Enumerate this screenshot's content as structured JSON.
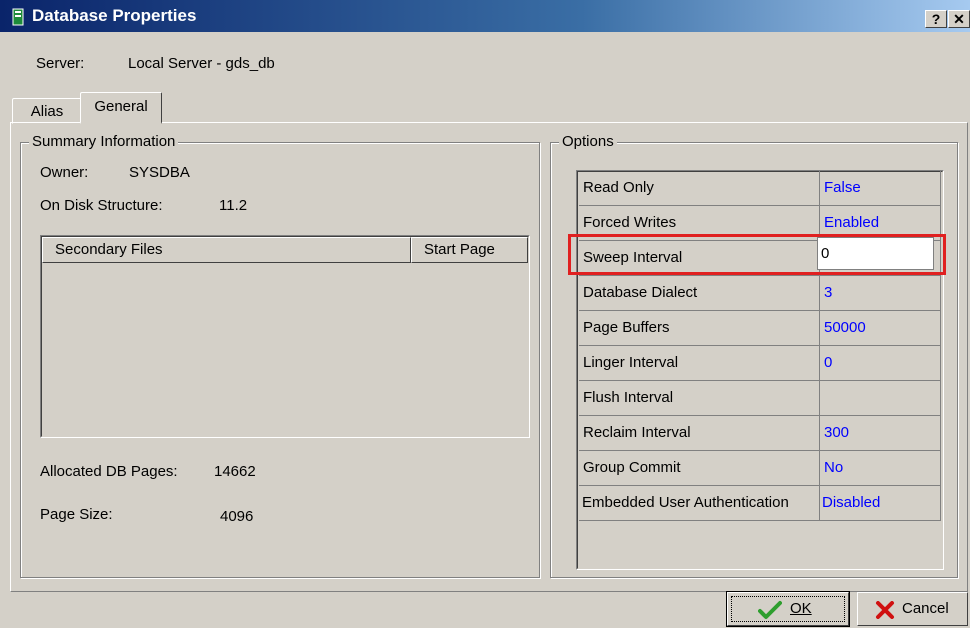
{
  "window": {
    "title": "Database Properties",
    "help_label": "?",
    "close_label": "✕"
  },
  "server": {
    "label": "Server:",
    "value": "Local Server - gds_db"
  },
  "tabs": [
    {
      "label": "Alias"
    },
    {
      "label": "General"
    }
  ],
  "summary": {
    "title": "Summary Information",
    "owner_label": "Owner:",
    "owner_value": "SYSDBA",
    "ods_label": "On Disk Structure:",
    "ods_value": "11.2",
    "columns": [
      "Secondary Files",
      "Start Page"
    ],
    "allocated_label": "Allocated DB Pages:",
    "allocated_value": "14662",
    "page_size_label": "Page Size:",
    "page_size_value": "4096"
  },
  "options": {
    "title": "Options",
    "rows": [
      {
        "name": "Read Only",
        "value": "False"
      },
      {
        "name": "Forced Writes",
        "value": "Enabled"
      },
      {
        "name": "Sweep Interval",
        "value": "0"
      },
      {
        "name": "Database Dialect",
        "value": "3"
      },
      {
        "name": "Page Buffers",
        "value": "50000"
      },
      {
        "name": "Linger Interval",
        "value": "0"
      },
      {
        "name": "Flush Interval",
        "value": ""
      },
      {
        "name": "Reclaim Interval",
        "value": "300"
      },
      {
        "name": "Group Commit",
        "value": "No"
      },
      {
        "name": "Embedded User Authentication",
        "value": "Disabled"
      }
    ]
  },
  "buttons": {
    "ok": "OK",
    "cancel": "Cancel"
  },
  "colors": {
    "highlight": "#e02020",
    "value_text": "#0000ff",
    "title_bar": "#0a246a"
  }
}
